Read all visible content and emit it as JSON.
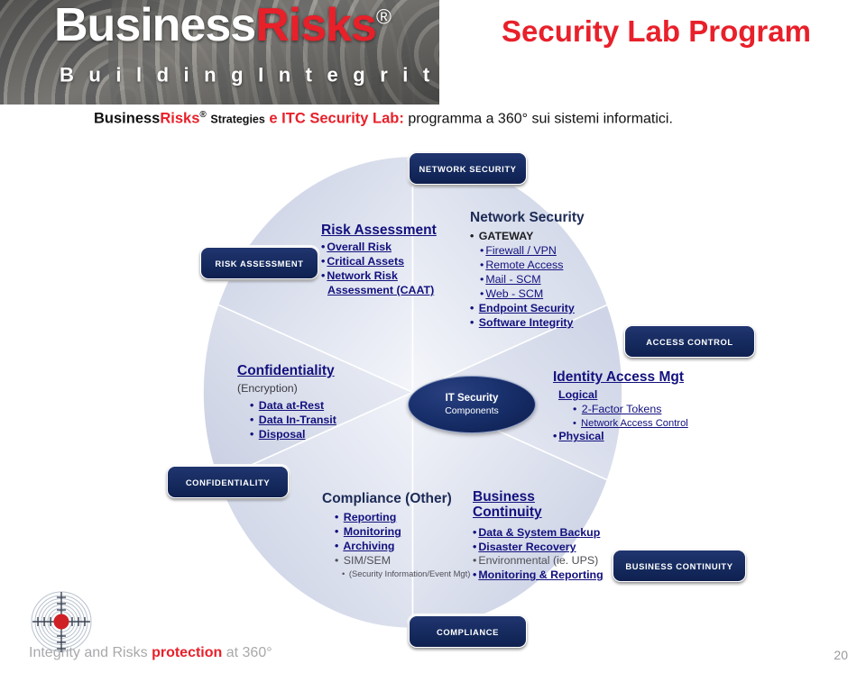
{
  "header": {
    "brand": {
      "word_business": "Business",
      "word_risks": "Risks",
      "registered": "®",
      "tagline": "B u i l d i n g   I n t e g r i t y"
    },
    "title": "Security Lab Program"
  },
  "subtitle": {
    "brand_business": "Business",
    "brand_risks": "Risks",
    "registered": "®",
    "strategies": "Strategies",
    "red_part": "e ITC Security Lab:",
    "rest": " programma a 360° sui sistemi informatici."
  },
  "diagram": {
    "center": {
      "line1": "IT Security",
      "line2": "Components"
    },
    "badges": [
      {
        "id": "network-security",
        "label": "Network Security"
      },
      {
        "id": "risk-assessment",
        "label": "Risk Assessment"
      },
      {
        "id": "access-control",
        "label": "Access Control"
      },
      {
        "id": "confidentiality",
        "label": "Confidentiality"
      },
      {
        "id": "business-continuity",
        "label": "Business Continuity"
      },
      {
        "id": "compliance",
        "label": "Compliance"
      }
    ],
    "segments": [
      {
        "id": "risk-assessment",
        "heading": "Risk Assessment",
        "items": [
          "Overall Risk",
          "Critical Assets",
          "Network Risk",
          "Assessment (CAAT)"
        ]
      },
      {
        "id": "network-security",
        "heading": "Network Security",
        "items": [
          "GATEWAY",
          "Firewall / VPN",
          "Remote Access",
          "Mail - SCM",
          "Web - SCM",
          "Endpoint Security",
          "Software Integrity"
        ]
      },
      {
        "id": "identity-access-mgt",
        "heading": "Identity Access Mgt",
        "items": [
          "Logical",
          "2-Factor Tokens",
          "Network Access Control",
          "Physical"
        ]
      },
      {
        "id": "business-continuity",
        "heading_line1": "Business",
        "heading_line2": "Continuity",
        "items": [
          "Data & System Backup",
          "Disaster Recovery",
          "Environmental (ie. UPS)",
          "Monitoring & Reporting"
        ]
      },
      {
        "id": "compliance-other",
        "heading": "Compliance (Other)",
        "items": [
          "Reporting",
          "Monitoring",
          "Archiving",
          "SIM/SEM",
          "(Security Information/Event Mgt)"
        ]
      },
      {
        "id": "confidentiality",
        "heading": "Confidentiality",
        "subheading": "(Encryption)",
        "items": [
          "Data at-Rest",
          "Data In-Transit",
          "Disposal"
        ]
      }
    ]
  },
  "footer": {
    "text_grey_1": "Integrity and Risks ",
    "text_red": "protection",
    "text_grey_2": " at 360°",
    "page_number": "20"
  },
  "colors": {
    "brand_red": "#e8202a",
    "navy_badge": "#15295c",
    "link_blue": "#12107d",
    "segment_light": "#f0f2f8",
    "segment_dark": "#ccd2e4"
  }
}
